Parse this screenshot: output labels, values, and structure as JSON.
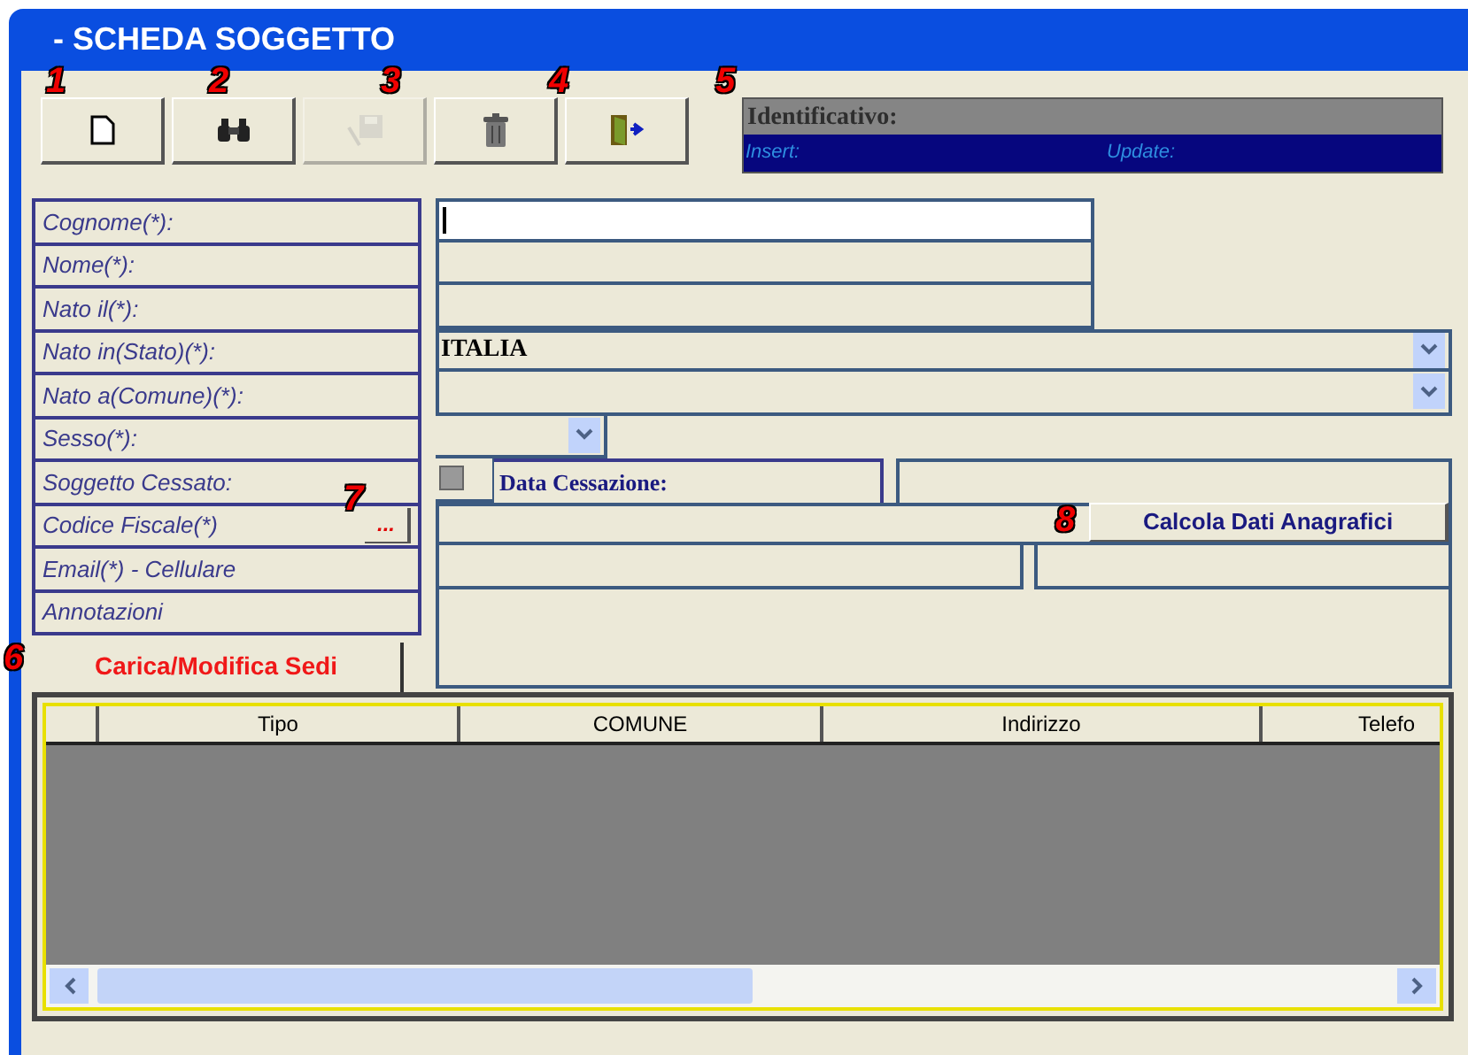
{
  "window": {
    "title": "- SCHEDA SOGGETTO"
  },
  "toolbar": [
    {
      "kind": "new",
      "disabled": false
    },
    {
      "kind": "search",
      "disabled": false
    },
    {
      "kind": "save",
      "disabled": true
    },
    {
      "kind": "delete",
      "disabled": false
    },
    {
      "kind": "exit",
      "disabled": false
    }
  ],
  "id_panel": {
    "title": "Identificativo:",
    "insert": "Insert:",
    "update": "Update:"
  },
  "labels": [
    "Cognome(*):",
    "Nome(*):",
    "Nato il(*):",
    "Nato in(Stato)(*):",
    "Nato a(Comune)(*):",
    "Sesso(*):",
    "Soggetto Cessato:",
    "Codice Fiscale(*)",
    "Email(*) - Cellulare",
    "Annotazioni"
  ],
  "nato_in_stato": {
    "value": "ITALIA"
  },
  "soggetto_cessato": {
    "checked": false,
    "date_label": "Data Cessazione:"
  },
  "codice_fiscale": {
    "lookup_button": "...",
    "calc_button": "Calcola Dati Anagrafici"
  },
  "sedi_button": "Carica/Modifica Sedi",
  "table": {
    "columns": [
      "Tipo",
      "COMUNE",
      "Indirizzo",
      "Telefo"
    ]
  },
  "annotations": [
    "1",
    "2",
    "3",
    "4",
    "5",
    "6",
    "7",
    "8"
  ]
}
